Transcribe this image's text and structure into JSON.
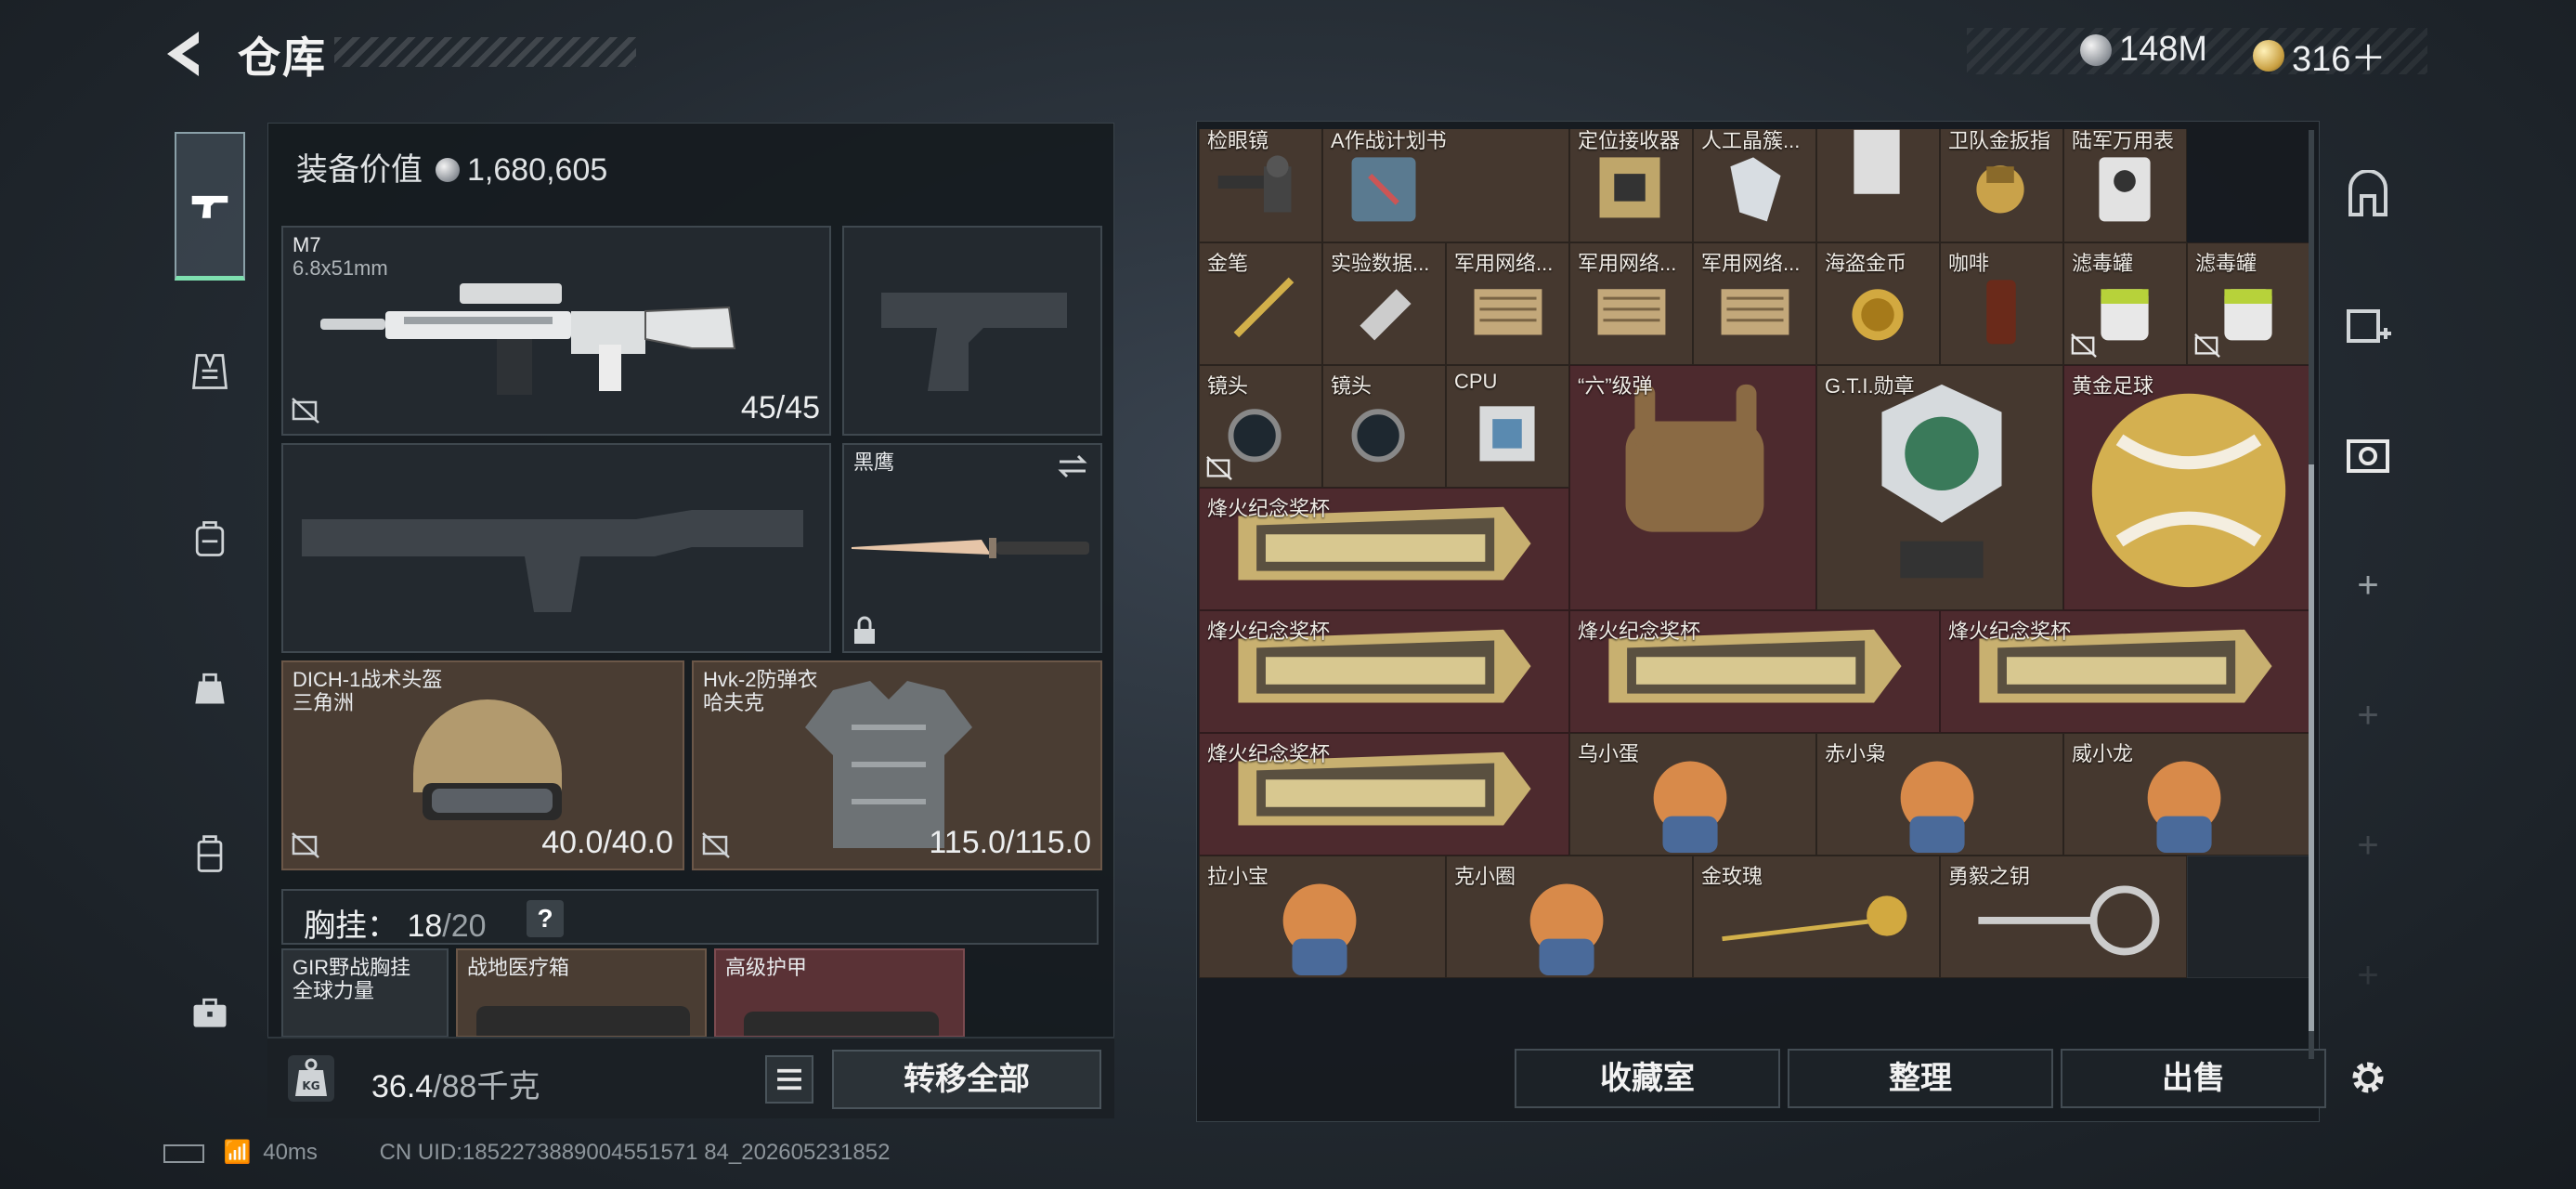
{
  "header": {
    "title": "仓库"
  },
  "currency": {
    "silver": "148M",
    "gold": "316＋"
  },
  "left_panel": {
    "equip_value_label": "装备价值",
    "equip_value": "1,680,605",
    "primary_weapon": {
      "name": "M7",
      "ammo": "6.8x51mm",
      "durability": "45/45"
    },
    "melee": {
      "name": "黑鹰"
    },
    "helmet": {
      "name": "DICH-1战术头盔",
      "sub": "三角洲",
      "durability": "40.0/40.0"
    },
    "armor": {
      "name": "Hvk-2防弹衣",
      "sub": "哈夫克",
      "durability": "115.0/115.0"
    },
    "chest_rig": {
      "label": "胸挂：",
      "used": "18",
      "sep": "/",
      "max": "20",
      "help": "?"
    },
    "rig_items": [
      {
        "name": "GIR野战胸挂",
        "sub": "全球力量"
      },
      {
        "name": "战地医疗箱"
      },
      {
        "name": "高级护甲"
      }
    ],
    "weight": {
      "current": "36.4",
      "max": "/88千克"
    },
    "transfer_all": "转移全部"
  },
  "grid": {
    "items": [
      "检眼镜",
      "A作战计划书",
      "定位接收器",
      "人工晶簇...",
      "卫队金扳指",
      "陆军万用表",
      "金笔",
      "实验数据...",
      "军用网络...",
      "军用网络...",
      "军用网络...",
      "海盗金币",
      "咖啡",
      "滤毒罐",
      "滤毒罐",
      "镜头",
      "镜头",
      "CPU",
      "“六”级弹",
      "G.T.I.勋章",
      "黄金足球",
      "烽火纪念奖杯",
      "烽火纪念奖杯",
      "烽火纪念奖杯",
      "烽火纪念奖杯",
      "烽火纪念奖杯",
      "乌小蛋",
      "赤小枭",
      "威小龙",
      "拉小宝",
      "克小圈",
      "金玫瑰",
      "勇毅之钥"
    ]
  },
  "actions": {
    "collection": "收藏室",
    "sort": "整理",
    "sell": "出售"
  },
  "status": {
    "ping": "40ms",
    "uid": "CN UID:1852273889004551571 84_202605231852"
  },
  "colors": {
    "accent": "#7fe0b0",
    "item_bg": "#45382f",
    "red_item_bg": "#4d2a2e"
  },
  "icons": [
    "back-arrow-icon",
    "pistol-icon",
    "vest-icon",
    "backpack-icon",
    "bag-icon",
    "case-icon",
    "toolbox-icon",
    "lock-icon",
    "no-drop-icon",
    "swap-icon",
    "kg-icon",
    "list-icon",
    "gear-icon",
    "plus-icon"
  ]
}
